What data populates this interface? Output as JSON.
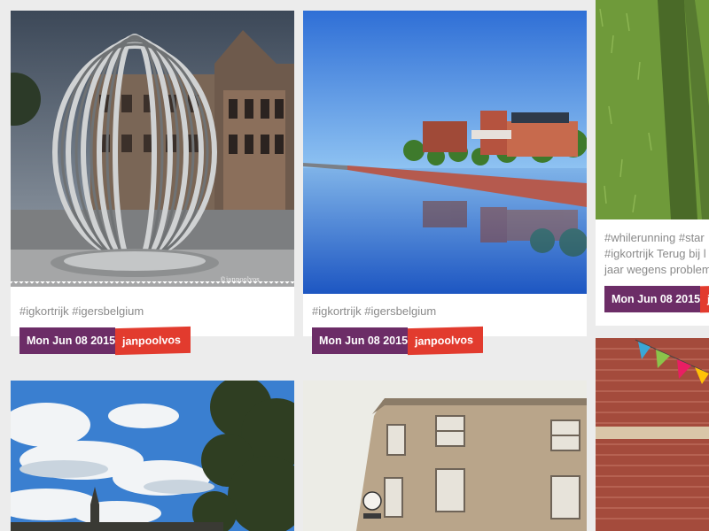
{
  "posts": [
    {
      "caption": "#igkortrijk #igersbelgium",
      "date": "Mon Jun 08 2015",
      "user": "janpoolvos",
      "watermark": "©janpoolvos"
    },
    {
      "caption": "#igkortrijk #igersbelgium",
      "date": "Mon Jun 08 2015",
      "user": "janpoolvos"
    },
    {
      "caption_lines": [
        "#whilerunning #star",
        "#igkortrijk Terug bij l",
        "jaar wegens problem"
      ],
      "date": "Mon Jun 08 2015",
      "user": "ja"
    },
    {
      "caption": "",
      "date": "",
      "user": ""
    },
    {
      "caption": "",
      "date": "",
      "user": ""
    },
    {
      "caption": "",
      "date": "",
      "user": ""
    }
  ],
  "colors": {
    "date_bg": "#6c2d67",
    "user_bg": "#e23b2e",
    "page_bg": "#ececec"
  }
}
